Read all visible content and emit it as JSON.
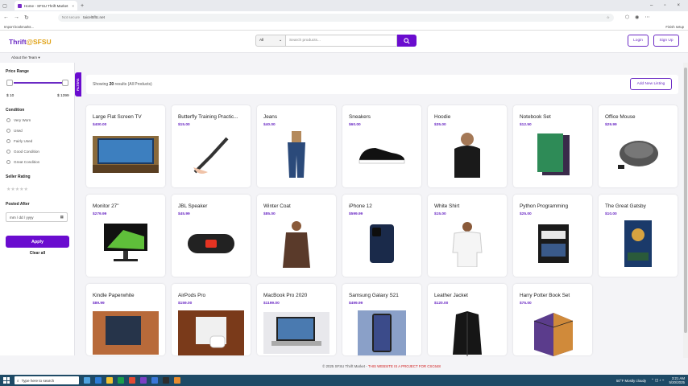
{
  "browser": {
    "tab_title": "Home - SFSU Thrift Market",
    "url_prefix": "Not secure",
    "url": "taicel5fltc.net",
    "bookmark": "Import bookmarks...",
    "bookmark_right": "Finish setup"
  },
  "header": {
    "logo_main": "Thrift",
    "logo_accent": "@SFSU",
    "search_category": "All",
    "search_placeholder": "Search products...",
    "login": "Login",
    "signup": "Sign Up"
  },
  "nav": {
    "about": "About the Team ▾"
  },
  "filters": {
    "tab": "FILTERS",
    "price_title": "Price Range",
    "price_min": "$ 10",
    "price_max": "$ 1399",
    "condition_title": "Condition",
    "conditions": [
      "Very Worn",
      "Used",
      "Fairly Used",
      "Good Condition",
      "Great Condition"
    ],
    "seller_title": "Seller Rating",
    "rating_stars": "★★★★★",
    "posted_title": "Posted After",
    "date_placeholder": "mm / dd / yyyy",
    "apply": "Apply",
    "clear": "Clear all"
  },
  "results": {
    "prefix": "Showing ",
    "count": "20",
    "suffix": " results (All Products)",
    "add_listing": "Add New Listing"
  },
  "products": [
    {
      "title": "Large Flat Screen TV",
      "price": "$400.00",
      "icon": "tv"
    },
    {
      "title": "Butterfly Training Practic...",
      "price": "$15.00",
      "icon": "butterfly-knife"
    },
    {
      "title": "Jeans",
      "price": "$40.00",
      "icon": "jeans"
    },
    {
      "title": "Sneakers",
      "price": "$60.00",
      "icon": "sneaker"
    },
    {
      "title": "Hoodie",
      "price": "$35.00",
      "icon": "hoodie"
    },
    {
      "title": "Notebook Set",
      "price": "$12.50",
      "icon": "notebook"
    },
    {
      "title": "Office Mouse",
      "price": "$29.99",
      "icon": "mouse"
    },
    {
      "title": "Monitor 27\"",
      "price": "$279.99",
      "icon": "monitor"
    },
    {
      "title": "JBL Speaker",
      "price": "$45.99",
      "icon": "speaker"
    },
    {
      "title": "Winter Coat",
      "price": "$85.00",
      "icon": "coat"
    },
    {
      "title": "iPhone 12",
      "price": "$599.99",
      "icon": "phone"
    },
    {
      "title": "White Shirt",
      "price": "$15.00",
      "icon": "shirt"
    },
    {
      "title": "Python Programming",
      "price": "$25.00",
      "icon": "book"
    },
    {
      "title": "The Great Gatsby",
      "price": "$10.00",
      "icon": "book-blue"
    },
    {
      "title": "Kindle Paperwhite",
      "price": "$89.99",
      "icon": "kindle"
    },
    {
      "title": "AirPods Pro",
      "price": "$159.00",
      "icon": "airpods"
    },
    {
      "title": "MacBook Pro 2020",
      "price": "$1199.00",
      "icon": "laptop"
    },
    {
      "title": "Samsung Galaxy S21",
      "price": "$499.99",
      "icon": "phone-android"
    },
    {
      "title": "Leather Jacket",
      "price": "$120.00",
      "icon": "jacket"
    },
    {
      "title": "Harry Potter Book Set",
      "price": "$75.00",
      "icon": "book-box"
    }
  ],
  "footer": {
    "text": "© 2025 SFSU Thrift Market - ",
    "warning": "THIS WEBSITE IS A PROJECT FOR CSC648"
  },
  "taskbar": {
    "search": "Type here to search",
    "weather": "50°F  Mostly cloudy",
    "time": "3:21 AM",
    "date": "5/20/2025"
  },
  "colors": {
    "accent": "#6a0ccf",
    "logo_gold": "#e0a318",
    "price": "#6b2ac4"
  }
}
